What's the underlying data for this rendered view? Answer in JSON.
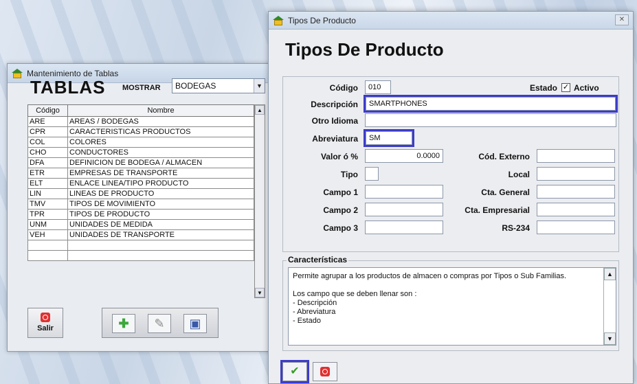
{
  "left_window": {
    "title": "Mantenimiento de Tablas",
    "heading": "TABLAS",
    "mostrar_label": "MOSTRAR",
    "mostrar_value": "BODEGAS",
    "columns": [
      "Código",
      "Nombre"
    ],
    "rows": [
      [
        "ARE",
        "AREAS / BODEGAS"
      ],
      [
        "CPR",
        "CARACTERISTICAS PRODUCTOS"
      ],
      [
        "COL",
        "COLORES"
      ],
      [
        "CHO",
        "CONDUCTORES"
      ],
      [
        "DFA",
        "DEFINICION DE BODEGA / ALMACEN"
      ],
      [
        "ETR",
        "EMPRESAS DE TRANSPORTE"
      ],
      [
        "ELT",
        "ENLACE LINEA/TIPO PRODUCTO"
      ],
      [
        "LIN",
        "LINEAS DE PRODUCTO"
      ],
      [
        "TMV",
        "TIPOS DE MOVIMIENTO"
      ],
      [
        "TPR",
        "TIPOS DE PRODUCTO"
      ],
      [
        "UNM",
        "UNIDADES DE MEDIDA"
      ],
      [
        "VEH",
        "UNIDADES DE TRANSPORTE"
      ],
      [
        "",
        ""
      ],
      [
        "",
        ""
      ]
    ],
    "salir_label": "Salir"
  },
  "right_window": {
    "title": "Tipos De Producto",
    "close_glyph": "⌥",
    "heading": "Tipos De Producto",
    "codigo_label": "Código",
    "codigo_value": "010",
    "estado_label": "Estado",
    "activo_label": "Activo",
    "activo_checked": "✓",
    "descripcion_label": "Descripción",
    "descripcion_value": "SMARTPHONES",
    "otro_idioma_label": "Otro Idioma",
    "otro_idioma_value": "",
    "abreviatura_label": "Abreviatura",
    "abreviatura_value": "SM",
    "valor_label": "Valor ó %",
    "valor_value": "0.0000",
    "cod_externo_label": "Cód. Externo",
    "cod_externo_value": "",
    "tipo_label": "Tipo",
    "tipo_value": "",
    "local_label": "Local",
    "local_value": "",
    "campo1_label": "Campo 1",
    "campo1_value": "",
    "cta_general_label": "Cta. General",
    "cta_general_value": "",
    "campo2_label": "Campo 2",
    "campo2_value": "",
    "cta_empresarial_label": "Cta. Empresarial",
    "cta_empresarial_value": "",
    "campo3_label": "Campo 3",
    "campo3_value": "",
    "rs234_label": "RS-234",
    "rs234_value": "",
    "caracteristicas_label": "Características",
    "caracteristicas_lines": [
      "Permite agrupar a los productos de almacen o compras por Tipos o Sub Familias.",
      "",
      "Los campo que se deben llenar son :",
      "- Descripción",
      "- Abreviatura",
      "- Estado"
    ],
    "ok_glyph": "✔"
  },
  "colors": {
    "focus_outline": "#3c3cc9",
    "power_red": "#e03030",
    "add_green": "#3aa83a"
  }
}
